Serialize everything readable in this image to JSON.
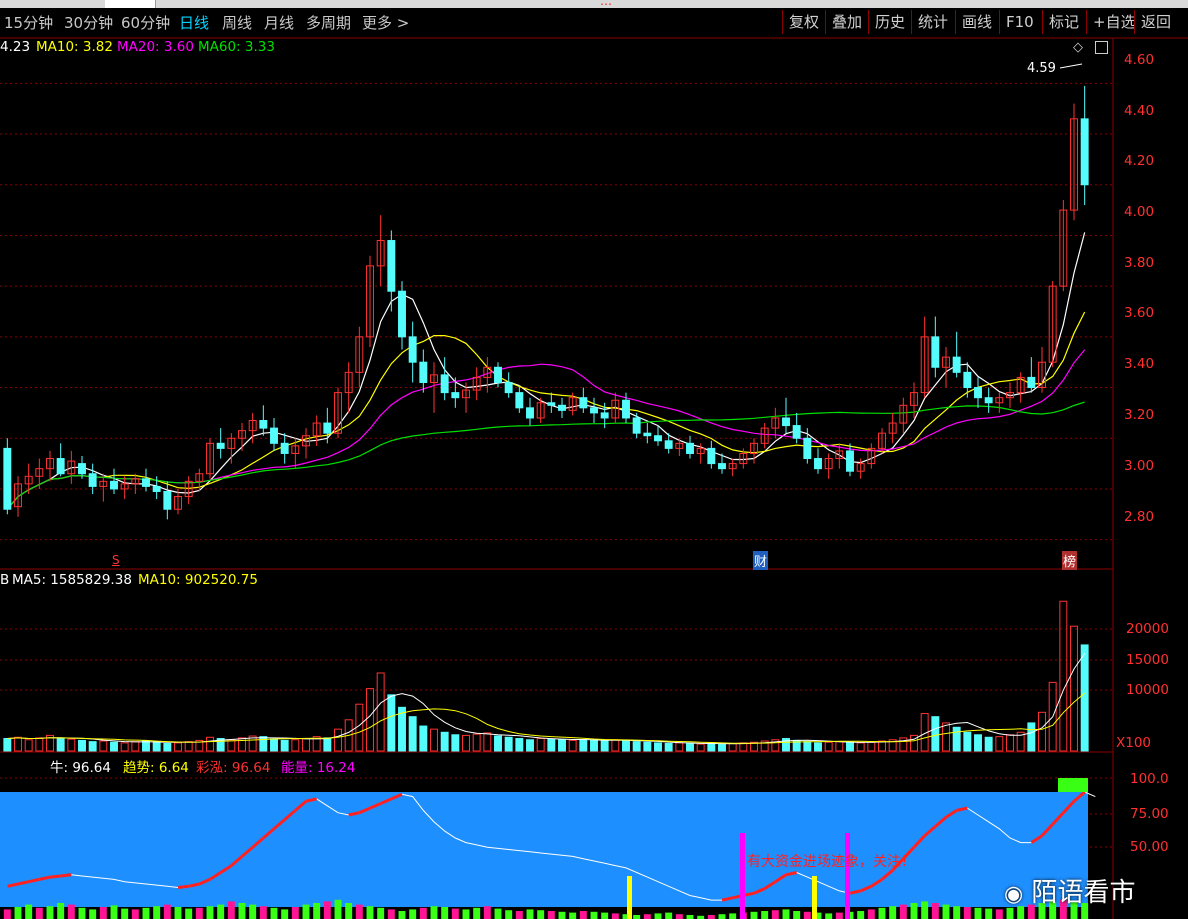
{
  "topstrip": {
    "red_text": "…"
  },
  "timeframes": [
    "15分钟",
    "30分钟",
    "60分钟",
    "日线",
    "周线",
    "月线",
    "多周期",
    "更多 >"
  ],
  "active_timeframe": "日线",
  "right_buttons": [
    "复权",
    "叠加",
    "历史",
    "统计",
    "画线",
    "F10",
    "标记",
    "+自选",
    "返回"
  ],
  "price_legend": {
    "ma5": "4.23",
    "ma10": "MA10: 3.82",
    "ma20": "MA20: 3.60",
    "ma60": "MA60: 3.33"
  },
  "volume_legend": {
    "vol": "B",
    "ma5": "MA5: 1585829.38",
    "ma10": "MA10: 902520.75"
  },
  "indicator_legend": {
    "niu": "牛: 96.64",
    "qushi": "趋势: 6.64",
    "caihong": "彩泓: 96.64",
    "nengliang": "能量: 16.24"
  },
  "price_axis": [
    "4.60",
    "4.40",
    "4.20",
    "4.00",
    "3.80",
    "3.60",
    "3.40",
    "3.20",
    "3.00",
    "2.80"
  ],
  "volume_axis": [
    "20000",
    "15000",
    "10000"
  ],
  "volume_unit": "X100",
  "indicator_axis": [
    "100.0",
    "75.00",
    "50.00"
  ],
  "max_price_label": "4.59",
  "markers": {
    "s": "S",
    "cai": "财",
    "bang": "榜"
  },
  "annotation": "有大资金进场迹象，关注！",
  "watermark": "陌语看市",
  "colors": {
    "up": "#ff3232",
    "down": "#54fcfc",
    "ma5": "#ffffff",
    "ma10": "#ffff00",
    "ma20": "#ff00ff",
    "ma60": "#00e000",
    "grid": "#8b0000",
    "indicator_bg": "#1e8fff"
  },
  "chart_data": {
    "type": "candlestick",
    "title": "",
    "price_ylim": [
      2.7,
      4.7
    ],
    "volume_ylim": [
      0,
      25000
    ],
    "indicator_ylim": [
      0,
      100
    ],
    "ohlc": [
      [
        3.16,
        3.2,
        2.9,
        2.92
      ],
      [
        2.93,
        3.05,
        2.89,
        3.02
      ],
      [
        3.02,
        3.1,
        2.98,
        3.05
      ],
      [
        3.05,
        3.12,
        3.0,
        3.08
      ],
      [
        3.08,
        3.15,
        3.03,
        3.12
      ],
      [
        3.12,
        3.18,
        3.05,
        3.06
      ],
      [
        3.06,
        3.15,
        3.02,
        3.11
      ],
      [
        3.1,
        3.13,
        3.04,
        3.06
      ],
      [
        3.06,
        3.1,
        2.98,
        3.01
      ],
      [
        3.01,
        3.06,
        2.95,
        3.03
      ],
      [
        3.03,
        3.08,
        2.98,
        3.0
      ],
      [
        3.0,
        3.05,
        2.96,
        3.02
      ],
      [
        3.02,
        3.06,
        2.98,
        3.04
      ],
      [
        3.04,
        3.08,
        2.99,
        3.01
      ],
      [
        3.01,
        3.05,
        2.96,
        2.99
      ],
      [
        2.99,
        3.03,
        2.88,
        2.92
      ],
      [
        2.92,
        3.0,
        2.9,
        2.97
      ],
      [
        2.97,
        3.05,
        2.94,
        3.03
      ],
      [
        3.03,
        3.08,
        2.99,
        3.06
      ],
      [
        3.06,
        3.2,
        3.04,
        3.18
      ],
      [
        3.18,
        3.24,
        3.12,
        3.16
      ],
      [
        3.16,
        3.22,
        3.1,
        3.2
      ],
      [
        3.2,
        3.26,
        3.15,
        3.23
      ],
      [
        3.23,
        3.3,
        3.18,
        3.27
      ],
      [
        3.27,
        3.33,
        3.21,
        3.24
      ],
      [
        3.24,
        3.28,
        3.15,
        3.18
      ],
      [
        3.18,
        3.22,
        3.1,
        3.14
      ],
      [
        3.14,
        3.2,
        3.08,
        3.17
      ],
      [
        3.17,
        3.24,
        3.12,
        3.21
      ],
      [
        3.21,
        3.29,
        3.17,
        3.26
      ],
      [
        3.26,
        3.32,
        3.18,
        3.22
      ],
      [
        3.22,
        3.4,
        3.2,
        3.38
      ],
      [
        3.38,
        3.5,
        3.3,
        3.46
      ],
      [
        3.46,
        3.64,
        3.4,
        3.6
      ],
      [
        3.6,
        3.92,
        3.56,
        3.88
      ],
      [
        3.88,
        4.08,
        3.8,
        3.98
      ],
      [
        3.98,
        4.02,
        3.7,
        3.78
      ],
      [
        3.78,
        3.82,
        3.55,
        3.6
      ],
      [
        3.6,
        3.66,
        3.42,
        3.5
      ],
      [
        3.5,
        3.55,
        3.38,
        3.42
      ],
      [
        3.42,
        3.5,
        3.3,
        3.45
      ],
      [
        3.45,
        3.52,
        3.35,
        3.38
      ],
      [
        3.38,
        3.44,
        3.32,
        3.36
      ],
      [
        3.36,
        3.42,
        3.3,
        3.39
      ],
      [
        3.39,
        3.48,
        3.35,
        3.44
      ],
      [
        3.44,
        3.52,
        3.38,
        3.48
      ],
      [
        3.48,
        3.5,
        3.4,
        3.42
      ],
      [
        3.42,
        3.46,
        3.36,
        3.38
      ],
      [
        3.38,
        3.41,
        3.3,
        3.32
      ],
      [
        3.32,
        3.36,
        3.25,
        3.28
      ],
      [
        3.28,
        3.36,
        3.26,
        3.34
      ],
      [
        3.34,
        3.38,
        3.3,
        3.33
      ],
      [
        3.33,
        3.36,
        3.28,
        3.31
      ],
      [
        3.31,
        3.38,
        3.29,
        3.36
      ],
      [
        3.36,
        3.4,
        3.3,
        3.32
      ],
      [
        3.32,
        3.36,
        3.26,
        3.3
      ],
      [
        3.3,
        3.34,
        3.24,
        3.28
      ],
      [
        3.28,
        3.38,
        3.26,
        3.35
      ],
      [
        3.35,
        3.38,
        3.26,
        3.28
      ],
      [
        3.28,
        3.3,
        3.2,
        3.22
      ],
      [
        3.22,
        3.26,
        3.18,
        3.21
      ],
      [
        3.21,
        3.25,
        3.17,
        3.19
      ],
      [
        3.19,
        3.22,
        3.14,
        3.16
      ],
      [
        3.16,
        3.2,
        3.13,
        3.18
      ],
      [
        3.18,
        3.21,
        3.12,
        3.14
      ],
      [
        3.14,
        3.18,
        3.1,
        3.16
      ],
      [
        3.16,
        3.19,
        3.08,
        3.1
      ],
      [
        3.1,
        3.14,
        3.06,
        3.08
      ],
      [
        3.08,
        3.12,
        3.05,
        3.1
      ],
      [
        3.1,
        3.16,
        3.08,
        3.14
      ],
      [
        3.14,
        3.2,
        3.1,
        3.18
      ],
      [
        3.18,
        3.26,
        3.16,
        3.24
      ],
      [
        3.24,
        3.32,
        3.2,
        3.28
      ],
      [
        3.28,
        3.36,
        3.22,
        3.25
      ],
      [
        3.25,
        3.3,
        3.18,
        3.2
      ],
      [
        3.2,
        3.24,
        3.1,
        3.12
      ],
      [
        3.12,
        3.16,
        3.06,
        3.08
      ],
      [
        3.08,
        3.14,
        3.04,
        3.12
      ],
      [
        3.12,
        3.18,
        3.08,
        3.15
      ],
      [
        3.15,
        3.18,
        3.05,
        3.07
      ],
      [
        3.07,
        3.12,
        3.04,
        3.1
      ],
      [
        3.1,
        3.18,
        3.08,
        3.16
      ],
      [
        3.16,
        3.24,
        3.14,
        3.22
      ],
      [
        3.22,
        3.3,
        3.18,
        3.26
      ],
      [
        3.26,
        3.36,
        3.22,
        3.33
      ],
      [
        3.33,
        3.42,
        3.28,
        3.38
      ],
      [
        3.38,
        3.68,
        3.36,
        3.6
      ],
      [
        3.6,
        3.68,
        3.44,
        3.48
      ],
      [
        3.48,
        3.56,
        3.4,
        3.52
      ],
      [
        3.52,
        3.62,
        3.44,
        3.46
      ],
      [
        3.46,
        3.5,
        3.36,
        3.4
      ],
      [
        3.4,
        3.44,
        3.32,
        3.36
      ],
      [
        3.36,
        3.4,
        3.3,
        3.34
      ],
      [
        3.34,
        3.38,
        3.3,
        3.36
      ],
      [
        3.36,
        3.42,
        3.32,
        3.38
      ],
      [
        3.38,
        3.46,
        3.34,
        3.44
      ],
      [
        3.44,
        3.52,
        3.38,
        3.4
      ],
      [
        3.4,
        3.56,
        3.38,
        3.5
      ],
      [
        3.5,
        3.82,
        3.48,
        3.8
      ],
      [
        3.8,
        4.14,
        3.78,
        4.1
      ],
      [
        4.1,
        4.52,
        4.06,
        4.46
      ],
      [
        4.46,
        4.59,
        4.12,
        4.2
      ]
    ],
    "volume": [
      2000,
      2200,
      1800,
      2100,
      2500,
      2000,
      1900,
      1700,
      1500,
      1600,
      1400,
      1300,
      1500,
      1600,
      1400,
      1200,
      1300,
      1500,
      1700,
      2200,
      2000,
      1800,
      2100,
      2400,
      2300,
      1900,
      1700,
      1800,
      2000,
      2300,
      2100,
      3500,
      5000,
      7500,
      10000,
      12500,
      9000,
      7000,
      5500,
      4000,
      3500,
      3000,
      2600,
      2500,
      2700,
      2900,
      2400,
      2200,
      2000,
      1800,
      2000,
      1900,
      1800,
      1700,
      1800,
      1700,
      1600,
      1800,
      1700,
      1500,
      1400,
      1300,
      1200,
      1300,
      1200,
      1100,
      1200,
      1100,
      1200,
      1300,
      1400,
      1600,
      1800,
      2000,
      1700,
      1500,
      1300,
      1400,
      1500,
      1400,
      1300,
      1400,
      1600,
      1800,
      2100,
      2500,
      6000,
      5500,
      4500,
      3800,
      3000,
      2600,
      2200,
      2300,
      2600,
      3000,
      4500,
      6200,
      11000,
      24000,
      20000,
      17000
    ],
    "indicator_niu": [
      18,
      20,
      22,
      24,
      26,
      27,
      28,
      27,
      26,
      25,
      24,
      22,
      21,
      20,
      19,
      18,
      17,
      18,
      20,
      24,
      30,
      36,
      44,
      52,
      60,
      68,
      76,
      84,
      92,
      94,
      88,
      82,
      80,
      82,
      86,
      90,
      94,
      98,
      96,
      84,
      74,
      66,
      60,
      56,
      54,
      52,
      51,
      50,
      49,
      48,
      47,
      46,
      45,
      44,
      42,
      40,
      38,
      36,
      34,
      30,
      26,
      22,
      18,
      14,
      10,
      8,
      6,
      6,
      8,
      10,
      12,
      16,
      22,
      28,
      30,
      26,
      22,
      18,
      14,
      12,
      14,
      18,
      24,
      32,
      42,
      52,
      62,
      70,
      78,
      84,
      86,
      80,
      74,
      68,
      60,
      56,
      56,
      62,
      72,
      82,
      92,
      100,
      96
    ],
    "indicator_bars": [
      12,
      15,
      18,
      14,
      16,
      20,
      18,
      14,
      12,
      15,
      17,
      13,
      12,
      14,
      16,
      18,
      15,
      13,
      14,
      16,
      18,
      22,
      20,
      18,
      16,
      14,
      12,
      15,
      18,
      20,
      22,
      24,
      20,
      18,
      16,
      14,
      12,
      10,
      12,
      14,
      16,
      15,
      13,
      12,
      14,
      16,
      13,
      11,
      10,
      12,
      11,
      10,
      9,
      8,
      10,
      9,
      8,
      7,
      6,
      5,
      6,
      7,
      8,
      6,
      5,
      4,
      5,
      6,
      7,
      8,
      9,
      10,
      11,
      12,
      10,
      9,
      8,
      7,
      8,
      9,
      10,
      12,
      14,
      16,
      18,
      20,
      22,
      20,
      18,
      16,
      15,
      14,
      13,
      12,
      14,
      16,
      18,
      20,
      22,
      24,
      22,
      20
    ]
  }
}
